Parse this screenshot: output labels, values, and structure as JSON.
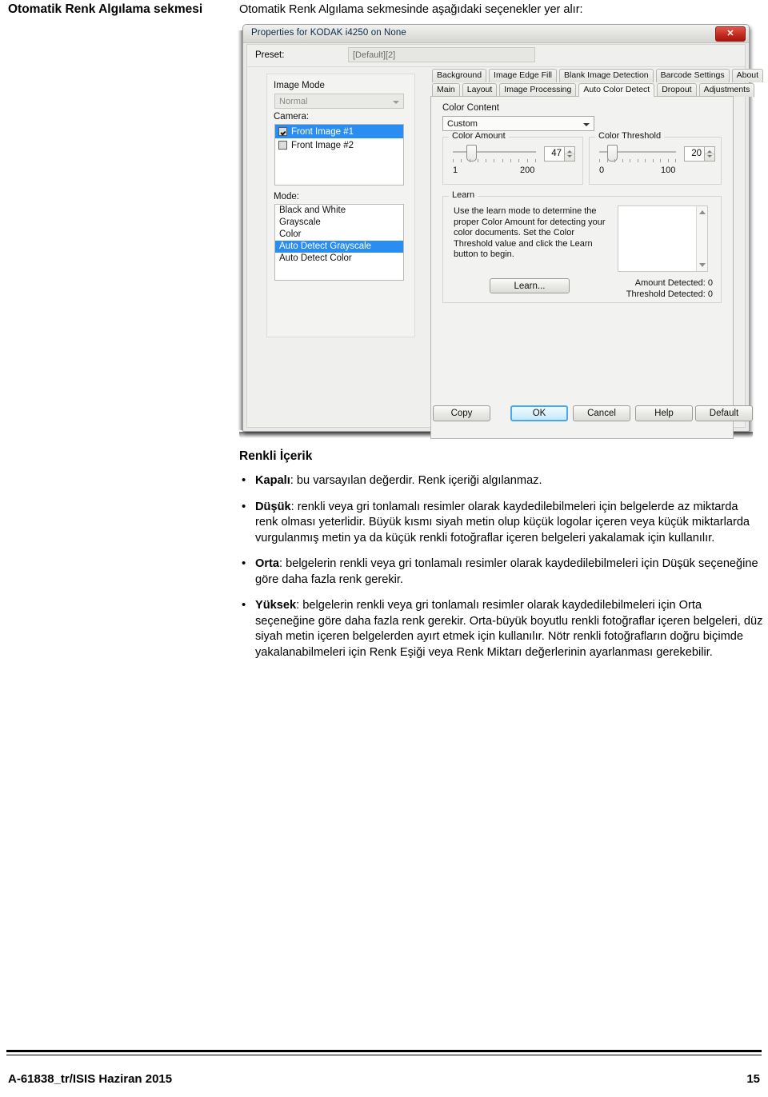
{
  "margin_heading": "Otomatik Renk Algılama sekmesi",
  "intro": "Otomatik Renk Algılama sekmesinde aşağıdaki seçenekler yer alır:",
  "dialog": {
    "title": "Properties for KODAK i4250 on None",
    "close_label": "✕",
    "preset": {
      "label": "Preset:",
      "value": "[Default][2]"
    },
    "image_mode": {
      "group_label": "Image Mode",
      "combo_value": "Normal",
      "camera_label": "Camera:",
      "cameras": [
        {
          "label": "Front Image #1",
          "checked": true,
          "selected": true
        },
        {
          "label": "Front Image #2",
          "checked": false,
          "selected": false
        }
      ],
      "mode_label": "Mode:",
      "modes": [
        {
          "label": "Black and White",
          "selected": false
        },
        {
          "label": "Grayscale",
          "selected": false
        },
        {
          "label": "Color",
          "selected": false
        },
        {
          "label": "Auto Detect Grayscale",
          "selected": true
        },
        {
          "label": "Auto Detect Color",
          "selected": false
        }
      ]
    },
    "tabs_row1": [
      {
        "label": "Background",
        "active": false
      },
      {
        "label": "Image Edge Fill",
        "active": false
      },
      {
        "label": "Blank Image Detection",
        "active": false
      },
      {
        "label": "Barcode Settings",
        "active": false
      },
      {
        "label": "About",
        "active": false
      }
    ],
    "tabs_row2": [
      {
        "label": "Main",
        "active": false
      },
      {
        "label": "Layout",
        "active": false
      },
      {
        "label": "Image Processing",
        "active": false
      },
      {
        "label": "Auto Color Detect",
        "active": true
      },
      {
        "label": "Dropout",
        "active": false
      },
      {
        "label": "Adjustments",
        "active": false
      }
    ],
    "color_content": {
      "group_label": "Color Content",
      "combo_value": "Custom",
      "color_amount": {
        "label": "Color Amount",
        "value": "47",
        "min_label": "1",
        "max_label": "200",
        "thumb_pct": 24
      },
      "color_threshold": {
        "label": "Color Threshold",
        "value": "20",
        "min_label": "0",
        "max_label": "100",
        "thumb_pct": 19
      }
    },
    "learn": {
      "group_label": "Learn",
      "description": "Use the learn mode to determine the proper Color Amount for detecting your color documents. Set the Color Threshold value and click the Learn button to begin.",
      "button": "Learn...",
      "amount_detected": "Amount Detected:  0",
      "threshold_detected": "Threshold Detected:  0"
    },
    "buttons": [
      {
        "label": "Copy",
        "primary": false
      },
      {
        "label": "OK",
        "primary": true
      },
      {
        "label": "Cancel",
        "primary": false
      },
      {
        "label": "Help",
        "primary": false
      },
      {
        "label": "Default",
        "primary": false
      }
    ]
  },
  "section": {
    "heading": "Renkli İçerik",
    "bullets": [
      {
        "term": "Kapalı",
        "text": ": bu varsayılan değerdir. Renk içeriği algılanmaz."
      },
      {
        "term": "Düşük",
        "text": ": renkli veya gri tonlamalı resimler olarak kaydedilebilmeleri için belgelerde az miktarda renk olması yeterlidir. Büyük kısmı siyah metin olup küçük logolar içeren veya küçük miktarlarda vurgulanmış metin ya da küçük renkli fotoğraflar içeren belgeleri yakalamak için kullanılır."
      },
      {
        "term": "Orta",
        "text": ": belgelerin renkli veya gri tonlamalı resimler olarak kaydedilebilmeleri için Düşük seçeneğine göre daha fazla renk gerekir."
      },
      {
        "term": "Yüksek",
        "text": ": belgelerin renkli veya gri tonlamalı resimler olarak kaydedilebilmeleri için Orta seçeneğine göre daha fazla renk gerekir. Orta-büyük boyutlu renkli fotoğraflar içeren belgeleri, düz siyah metin içeren belgelerden ayırt etmek için kullanılır. Nötr renkli fotoğrafların doğru biçimde yakalanabilmeleri için Renk Eşiği veya Renk Miktarı değerlerinin ayarlanması gerekebilir."
      }
    ]
  },
  "footer": {
    "left": "A-61838_tr/ISIS  Haziran 2015",
    "right": "15"
  }
}
